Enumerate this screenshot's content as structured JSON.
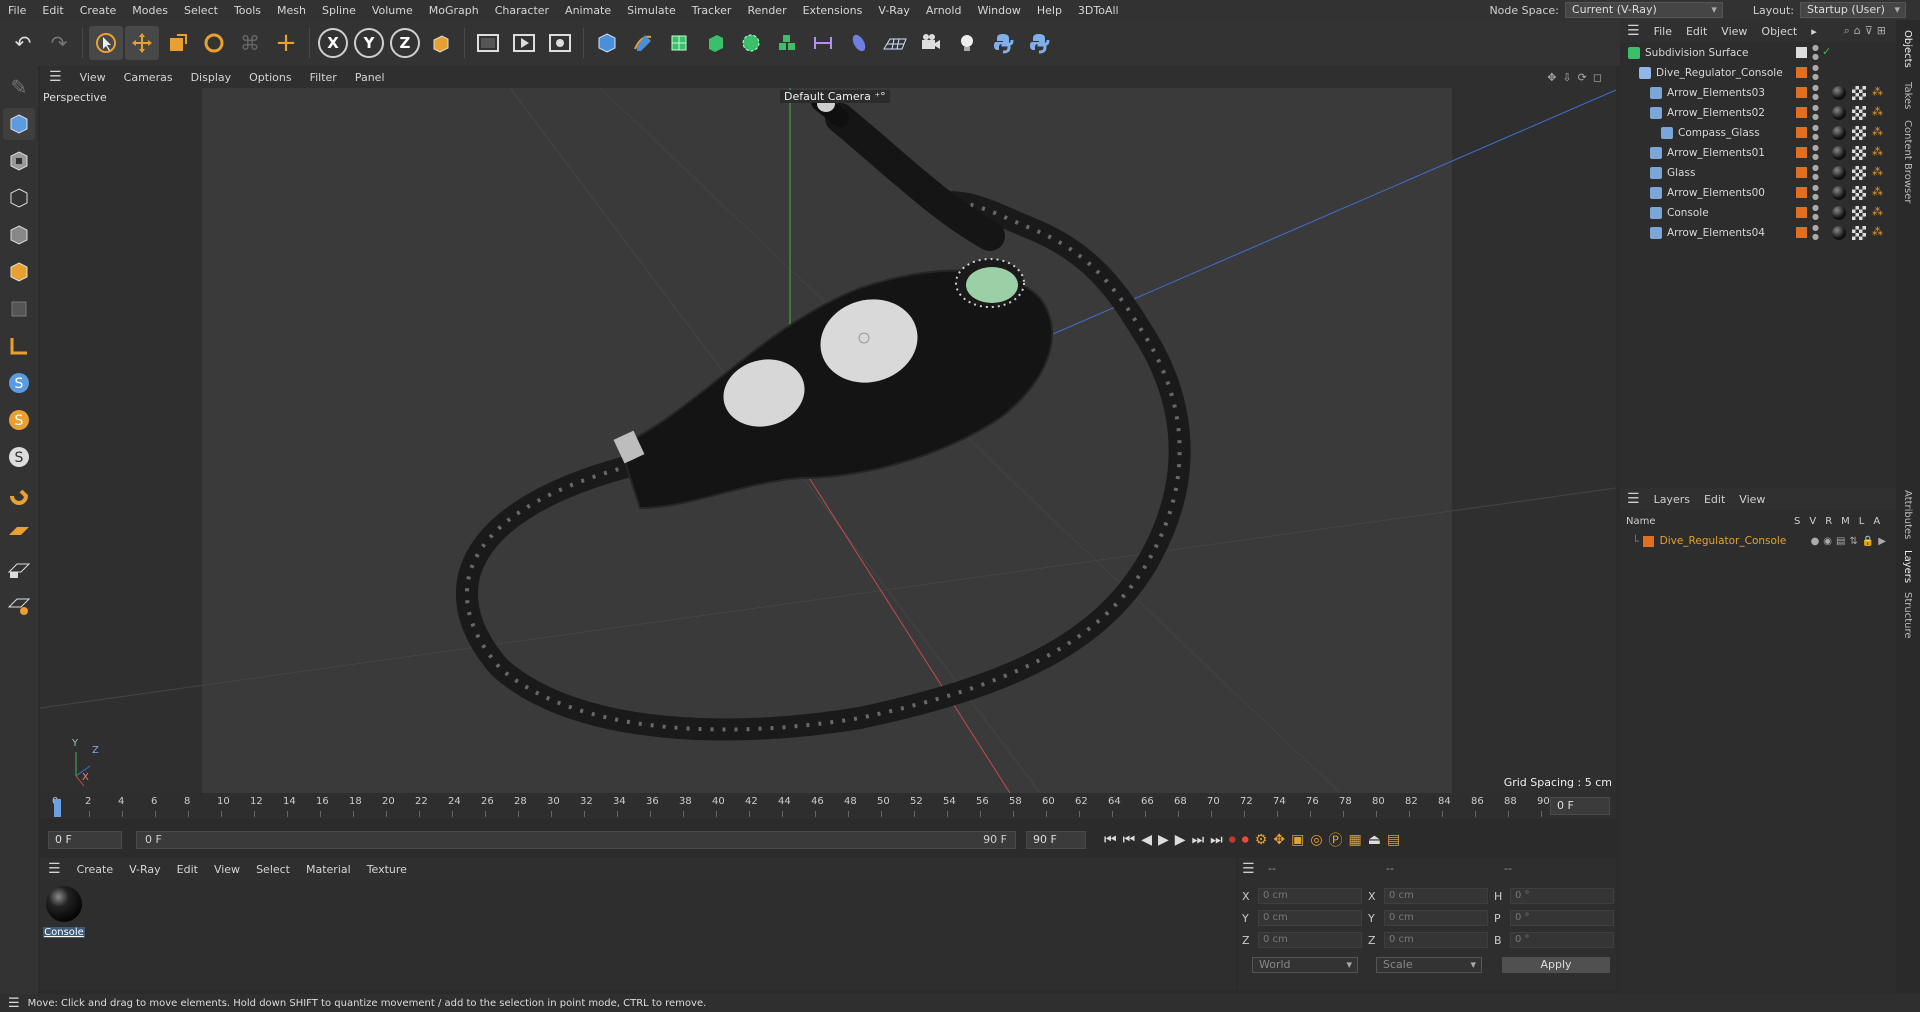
{
  "menubar": {
    "items": [
      "File",
      "Edit",
      "Create",
      "Modes",
      "Select",
      "Tools",
      "Mesh",
      "Spline",
      "Volume",
      "MoGraph",
      "Character",
      "Animate",
      "Simulate",
      "Tracker",
      "Render",
      "Extensions",
      "V-Ray",
      "Arnold",
      "Window",
      "Help",
      "3DToAll"
    ],
    "node_space_label": "Node Space:",
    "node_space_value": "Current (V-Ray)",
    "layout_label": "Layout:",
    "layout_value": "Startup (User)"
  },
  "viewport": {
    "menu": [
      "View",
      "Cameras",
      "Display",
      "Options",
      "Filter",
      "Panel"
    ],
    "label": "Perspective",
    "camera": "Default Camera",
    "grid_spacing": "Grid Spacing : 5 cm",
    "axis_labels": {
      "x": "X",
      "y": "Y",
      "z": "Z"
    }
  },
  "timeline": {
    "ticks": [
      "0",
      "2",
      "4",
      "6",
      "8",
      "10",
      "12",
      "14",
      "16",
      "18",
      "20",
      "22",
      "24",
      "26",
      "28",
      "30",
      "32",
      "34",
      "36",
      "38",
      "40",
      "42",
      "44",
      "46",
      "48",
      "50",
      "52",
      "54",
      "56",
      "58",
      "60",
      "62",
      "64",
      "66",
      "68",
      "70",
      "72",
      "74",
      "76",
      "78",
      "80",
      "82",
      "84",
      "86",
      "88",
      "90"
    ],
    "current_frame": "0 F",
    "start_field": "0 F",
    "range_start": "0 F",
    "range_end": "90 F",
    "end_field": "90 F"
  },
  "material_manager": {
    "menu": [
      "Create",
      "V-Ray",
      "Edit",
      "View",
      "Select",
      "Material",
      "Texture"
    ],
    "materials": [
      {
        "name": "Console"
      }
    ]
  },
  "coordinates": {
    "headers": [
      "--",
      "--",
      "--"
    ],
    "rows": [
      {
        "a": "X",
        "av": "0 cm",
        "b": "X",
        "bv": "0 cm",
        "c": "H",
        "cv": "0 °"
      },
      {
        "a": "Y",
        "av": "0 cm",
        "b": "Y",
        "bv": "0 cm",
        "c": "P",
        "cv": "0 °"
      },
      {
        "a": "Z",
        "av": "0 cm",
        "b": "Z",
        "bv": "0 cm",
        "c": "B",
        "cv": "0 °"
      }
    ],
    "world": "World",
    "scale": "Scale",
    "apply": "Apply"
  },
  "object_manager": {
    "menu": [
      "File",
      "Edit",
      "View",
      "Object"
    ],
    "objects": [
      {
        "name": "Subdivision Surface",
        "level": 0
      },
      {
        "name": "Dive_Regulator_Console",
        "level": 1
      },
      {
        "name": "Arrow_Elements03",
        "level": 2
      },
      {
        "name": "Arrow_Elements02",
        "level": 2
      },
      {
        "name": "Compass_Glass",
        "level": 3
      },
      {
        "name": "Arrow_Elements01",
        "level": 2
      },
      {
        "name": "Glass",
        "level": 2
      },
      {
        "name": "Arrow_Elements00",
        "level": 2
      },
      {
        "name": "Console",
        "level": 2
      },
      {
        "name": "Arrow_Elements04",
        "level": 2
      }
    ]
  },
  "layers": {
    "menu": [
      "Layers",
      "Edit",
      "View"
    ],
    "name_header": "Name",
    "col_headers": [
      "S",
      "V",
      "R",
      "M",
      "L",
      "A"
    ],
    "items": [
      {
        "name": "Dive_Regulator_Console",
        "color": "#e07020"
      }
    ]
  },
  "right_tabs": [
    "Objects",
    "Takes",
    "Content Browser",
    "Attributes",
    "Layers",
    "Structure"
  ],
  "status": "Move: Click and drag to move elements. Hold down SHIFT to quantize movement / add to the selection in point mode, CTRL to remove.",
  "colors": {
    "accent_orange": "#e07020",
    "grid_x": "#c84a4a",
    "grid_y": "#4ab04a",
    "grid_z": "#3f6fd0"
  }
}
